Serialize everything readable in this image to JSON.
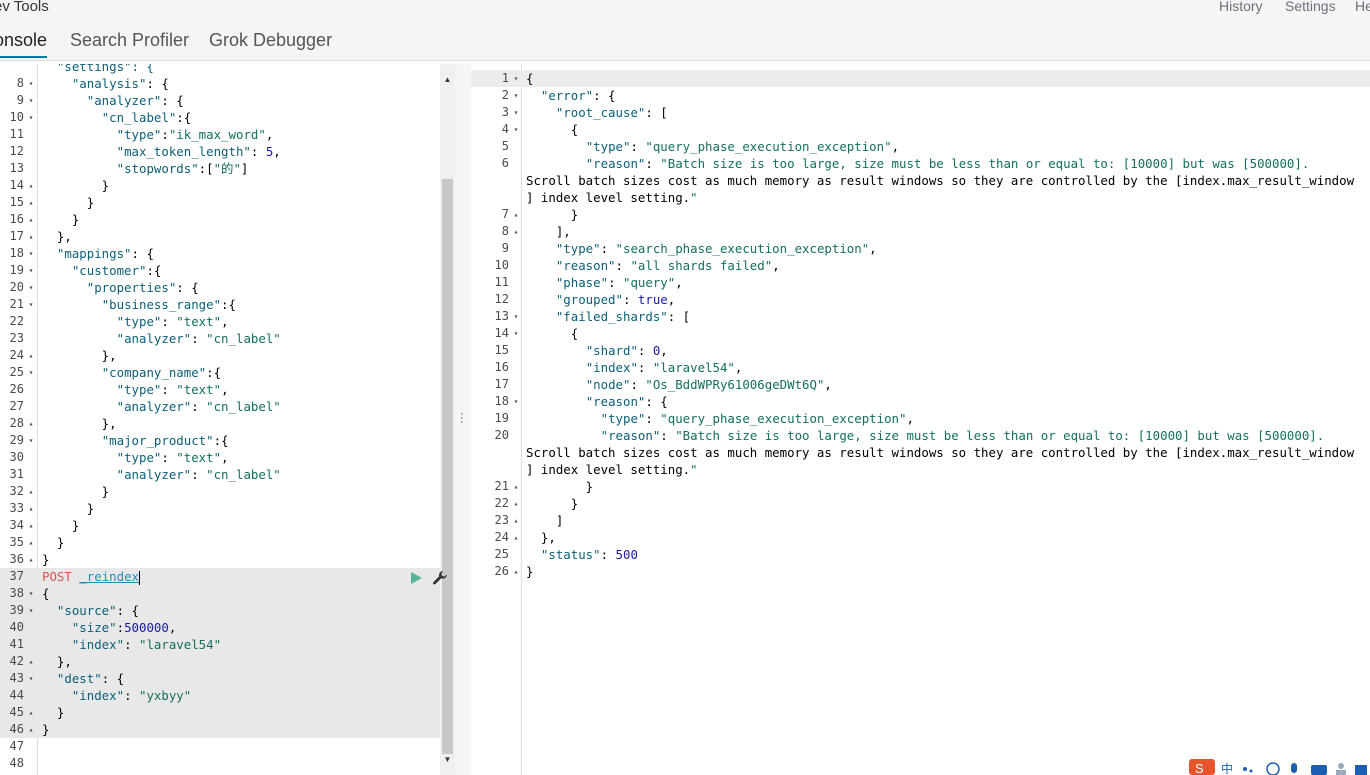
{
  "app": {
    "title": "ev Tools"
  },
  "header": {
    "links": [
      "History",
      "Settings",
      "He"
    ]
  },
  "tabs": [
    "onsole",
    "Search Profiler",
    "Grok Debugger"
  ],
  "active_tab": "onsole",
  "input_editor": {
    "partial_top_line": "  \"settings\": {",
    "lines": [
      {
        "n": "8",
        "f": "▾",
        "t": "    \"analysis\": {"
      },
      {
        "n": "9",
        "f": "▾",
        "t": "      \"analyzer\": {"
      },
      {
        "n": "10",
        "f": "▾",
        "t": "        \"cn_label\":{"
      },
      {
        "n": "11",
        "f": "",
        "t": "          \"type\":\"ik_max_word\","
      },
      {
        "n": "12",
        "f": "",
        "t": "          \"max_token_length\": 5,"
      },
      {
        "n": "13",
        "f": "",
        "t": "          \"stopwords\":[\"的\"]"
      },
      {
        "n": "14",
        "f": "▴",
        "t": "        }"
      },
      {
        "n": "15",
        "f": "▴",
        "t": "      }"
      },
      {
        "n": "16",
        "f": "▴",
        "t": "    }"
      },
      {
        "n": "17",
        "f": "▴",
        "t": "  },"
      },
      {
        "n": "18",
        "f": "▾",
        "t": "  \"mappings\": {"
      },
      {
        "n": "19",
        "f": "▾",
        "t": "    \"customer\":{"
      },
      {
        "n": "20",
        "f": "▾",
        "t": "      \"properties\": {"
      },
      {
        "n": "21",
        "f": "▾",
        "t": "        \"business_range\":{"
      },
      {
        "n": "22",
        "f": "",
        "t": "          \"type\": \"text\","
      },
      {
        "n": "23",
        "f": "",
        "t": "          \"analyzer\": \"cn_label\""
      },
      {
        "n": "24",
        "f": "▴",
        "t": "        },"
      },
      {
        "n": "25",
        "f": "▾",
        "t": "        \"company_name\":{"
      },
      {
        "n": "26",
        "f": "",
        "t": "          \"type\": \"text\","
      },
      {
        "n": "27",
        "f": "",
        "t": "          \"analyzer\": \"cn_label\""
      },
      {
        "n": "28",
        "f": "▴",
        "t": "        },"
      },
      {
        "n": "29",
        "f": "▾",
        "t": "        \"major_product\":{"
      },
      {
        "n": "30",
        "f": "",
        "t": "          \"type\": \"text\","
      },
      {
        "n": "31",
        "f": "",
        "t": "          \"analyzer\": \"cn_label\""
      },
      {
        "n": "32",
        "f": "▴",
        "t": "        }"
      },
      {
        "n": "33",
        "f": "▴",
        "t": "      }"
      },
      {
        "n": "34",
        "f": "▴",
        "t": "    }"
      },
      {
        "n": "35",
        "f": "▴",
        "t": "  }"
      },
      {
        "n": "36",
        "f": "▴",
        "t": "}"
      },
      {
        "n": "37",
        "f": "",
        "t": "POST _reindex",
        "req": true,
        "method": "POST",
        "path": "_reindex"
      },
      {
        "n": "38",
        "f": "▾",
        "t": "{",
        "req": true
      },
      {
        "n": "39",
        "f": "▾",
        "t": "  \"source\": {",
        "req": true
      },
      {
        "n": "40",
        "f": "",
        "t": "    \"size\":500000,",
        "req": true
      },
      {
        "n": "41",
        "f": "",
        "t": "    \"index\": \"laravel54\"",
        "req": true
      },
      {
        "n": "42",
        "f": "▴",
        "t": "  },",
        "req": true
      },
      {
        "n": "43",
        "f": "▾",
        "t": "  \"dest\": {",
        "req": true
      },
      {
        "n": "44",
        "f": "",
        "t": "    \"index\": \"yxbyy\"",
        "req": true
      },
      {
        "n": "45",
        "f": "▴",
        "t": "  }",
        "req": true
      },
      {
        "n": "46",
        "f": "▴",
        "t": "}",
        "req": true
      },
      {
        "n": "47",
        "f": "",
        "t": ""
      },
      {
        "n": "48",
        "f": "",
        "t": ""
      }
    ]
  },
  "output_editor": {
    "lines": [
      {
        "n": "1",
        "f": "▾",
        "t": "{",
        "hl": true
      },
      {
        "n": "2",
        "f": "▾",
        "t": "  \"error\": {"
      },
      {
        "n": "3",
        "f": "▾",
        "t": "    \"root_cause\": ["
      },
      {
        "n": "4",
        "f": "▾",
        "t": "      {"
      },
      {
        "n": "5",
        "f": "",
        "t": "        \"type\": \"query_phase_execution_exception\","
      },
      {
        "n": "6",
        "f": "",
        "t": "        \"reason\": \"Batch size is too large, size must be less than or equal to: [10000] but was [500000]."
      },
      {
        "n": "",
        "f": "",
        "t": "Scroll batch sizes cost as much memory as result windows so they are controlled by the [index.max_result_window"
      },
      {
        "n": "",
        "f": "",
        "t": "] index level setting.\""
      },
      {
        "n": "7",
        "f": "▴",
        "t": "      }"
      },
      {
        "n": "8",
        "f": "▴",
        "t": "    ],"
      },
      {
        "n": "9",
        "f": "",
        "t": "    \"type\": \"search_phase_execution_exception\","
      },
      {
        "n": "10",
        "f": "",
        "t": "    \"reason\": \"all shards failed\","
      },
      {
        "n": "11",
        "f": "",
        "t": "    \"phase\": \"query\","
      },
      {
        "n": "12",
        "f": "",
        "t": "    \"grouped\": true,"
      },
      {
        "n": "13",
        "f": "▾",
        "t": "    \"failed_shards\": ["
      },
      {
        "n": "14",
        "f": "▾",
        "t": "      {"
      },
      {
        "n": "15",
        "f": "",
        "t": "        \"shard\": 0,"
      },
      {
        "n": "16",
        "f": "",
        "t": "        \"index\": \"laravel54\","
      },
      {
        "n": "17",
        "f": "",
        "t": "        \"node\": \"Os_BddWPRy61006geDWt6Q\","
      },
      {
        "n": "18",
        "f": "▾",
        "t": "        \"reason\": {"
      },
      {
        "n": "19",
        "f": "",
        "t": "          \"type\": \"query_phase_execution_exception\","
      },
      {
        "n": "20",
        "f": "",
        "t": "          \"reason\": \"Batch size is too large, size must be less than or equal to: [10000] but was [500000]."
      },
      {
        "n": "",
        "f": "",
        "t": "Scroll batch sizes cost as much memory as result windows so they are controlled by the [index.max_result_window"
      },
      {
        "n": "",
        "f": "",
        "t": "] index level setting.\""
      },
      {
        "n": "21",
        "f": "▴",
        "t": "        }"
      },
      {
        "n": "22",
        "f": "▴",
        "t": "      }"
      },
      {
        "n": "23",
        "f": "▴",
        "t": "    ]"
      },
      {
        "n": "24",
        "f": "▴",
        "t": "  },"
      },
      {
        "n": "25",
        "f": "",
        "t": "  \"status\": 500"
      },
      {
        "n": "26",
        "f": "▴",
        "t": "}"
      }
    ]
  },
  "ime_toolbar": {
    "label": "中",
    "colors": {
      "logo": "#e8552d"
    }
  },
  "icons": [
    "play-icon",
    "wrench-icon",
    "resize-handle-icon",
    "scroll-up-icon",
    "scroll-down-icon"
  ],
  "colors": {
    "accent": "#0079a5",
    "method": "#d9534f",
    "run": "#54b399",
    "key": "#0c5f78",
    "string": "#146f60",
    "number": "#1a1aa6"
  }
}
